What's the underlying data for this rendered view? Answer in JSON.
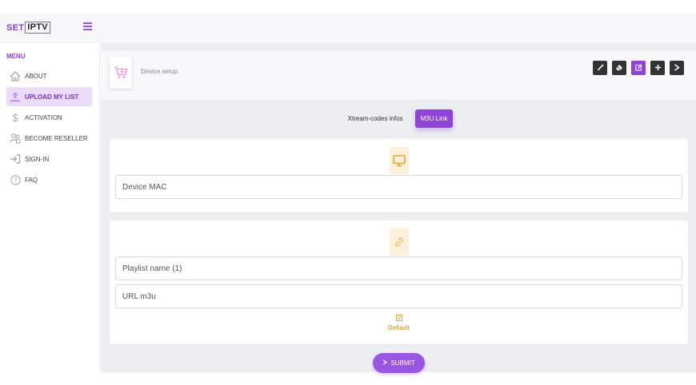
{
  "header": {
    "logo_set": "SET",
    "logo_iptv": "IPTV"
  },
  "sidebar": {
    "menu_title": "MENU",
    "items": [
      {
        "label": "ABOUT",
        "icon": "home-icon"
      },
      {
        "label": "UPLOAD MY LIST",
        "icon": "upload-icon",
        "active": true
      },
      {
        "label": "ACTIVATION",
        "icon": "dollar-icon"
      },
      {
        "label": "BECOME RESELLER",
        "icon": "reseller-icon"
      },
      {
        "label": "SIGN-IN",
        "icon": "sign-in-icon"
      },
      {
        "label": "FAQ",
        "icon": "question-icon"
      }
    ]
  },
  "setup": {
    "label": "Device setup",
    "icon": "cart-plus-icon"
  },
  "toolbar": [
    "brush-icon",
    "eraser-icon",
    "edit-icon",
    "plus-icon",
    "play-icon"
  ],
  "tabs": [
    {
      "label": "Xtream-codes infos"
    },
    {
      "label": "M3U Link",
      "active": true
    }
  ],
  "device_card": {
    "icon": "monitor-icon",
    "mac_placeholder": "Device MAC"
  },
  "playlist_card": {
    "icon": "link-icon",
    "name_placeholder": "Playlist name (1)",
    "url_placeholder": "URL m3u",
    "default_label": "Default"
  },
  "submit": {
    "label": "SUBMIT",
    "icon": "play-icon"
  },
  "colors": {
    "accent": "#8e44d4",
    "warning": "#e1a53b",
    "dark_button": "#333333"
  }
}
